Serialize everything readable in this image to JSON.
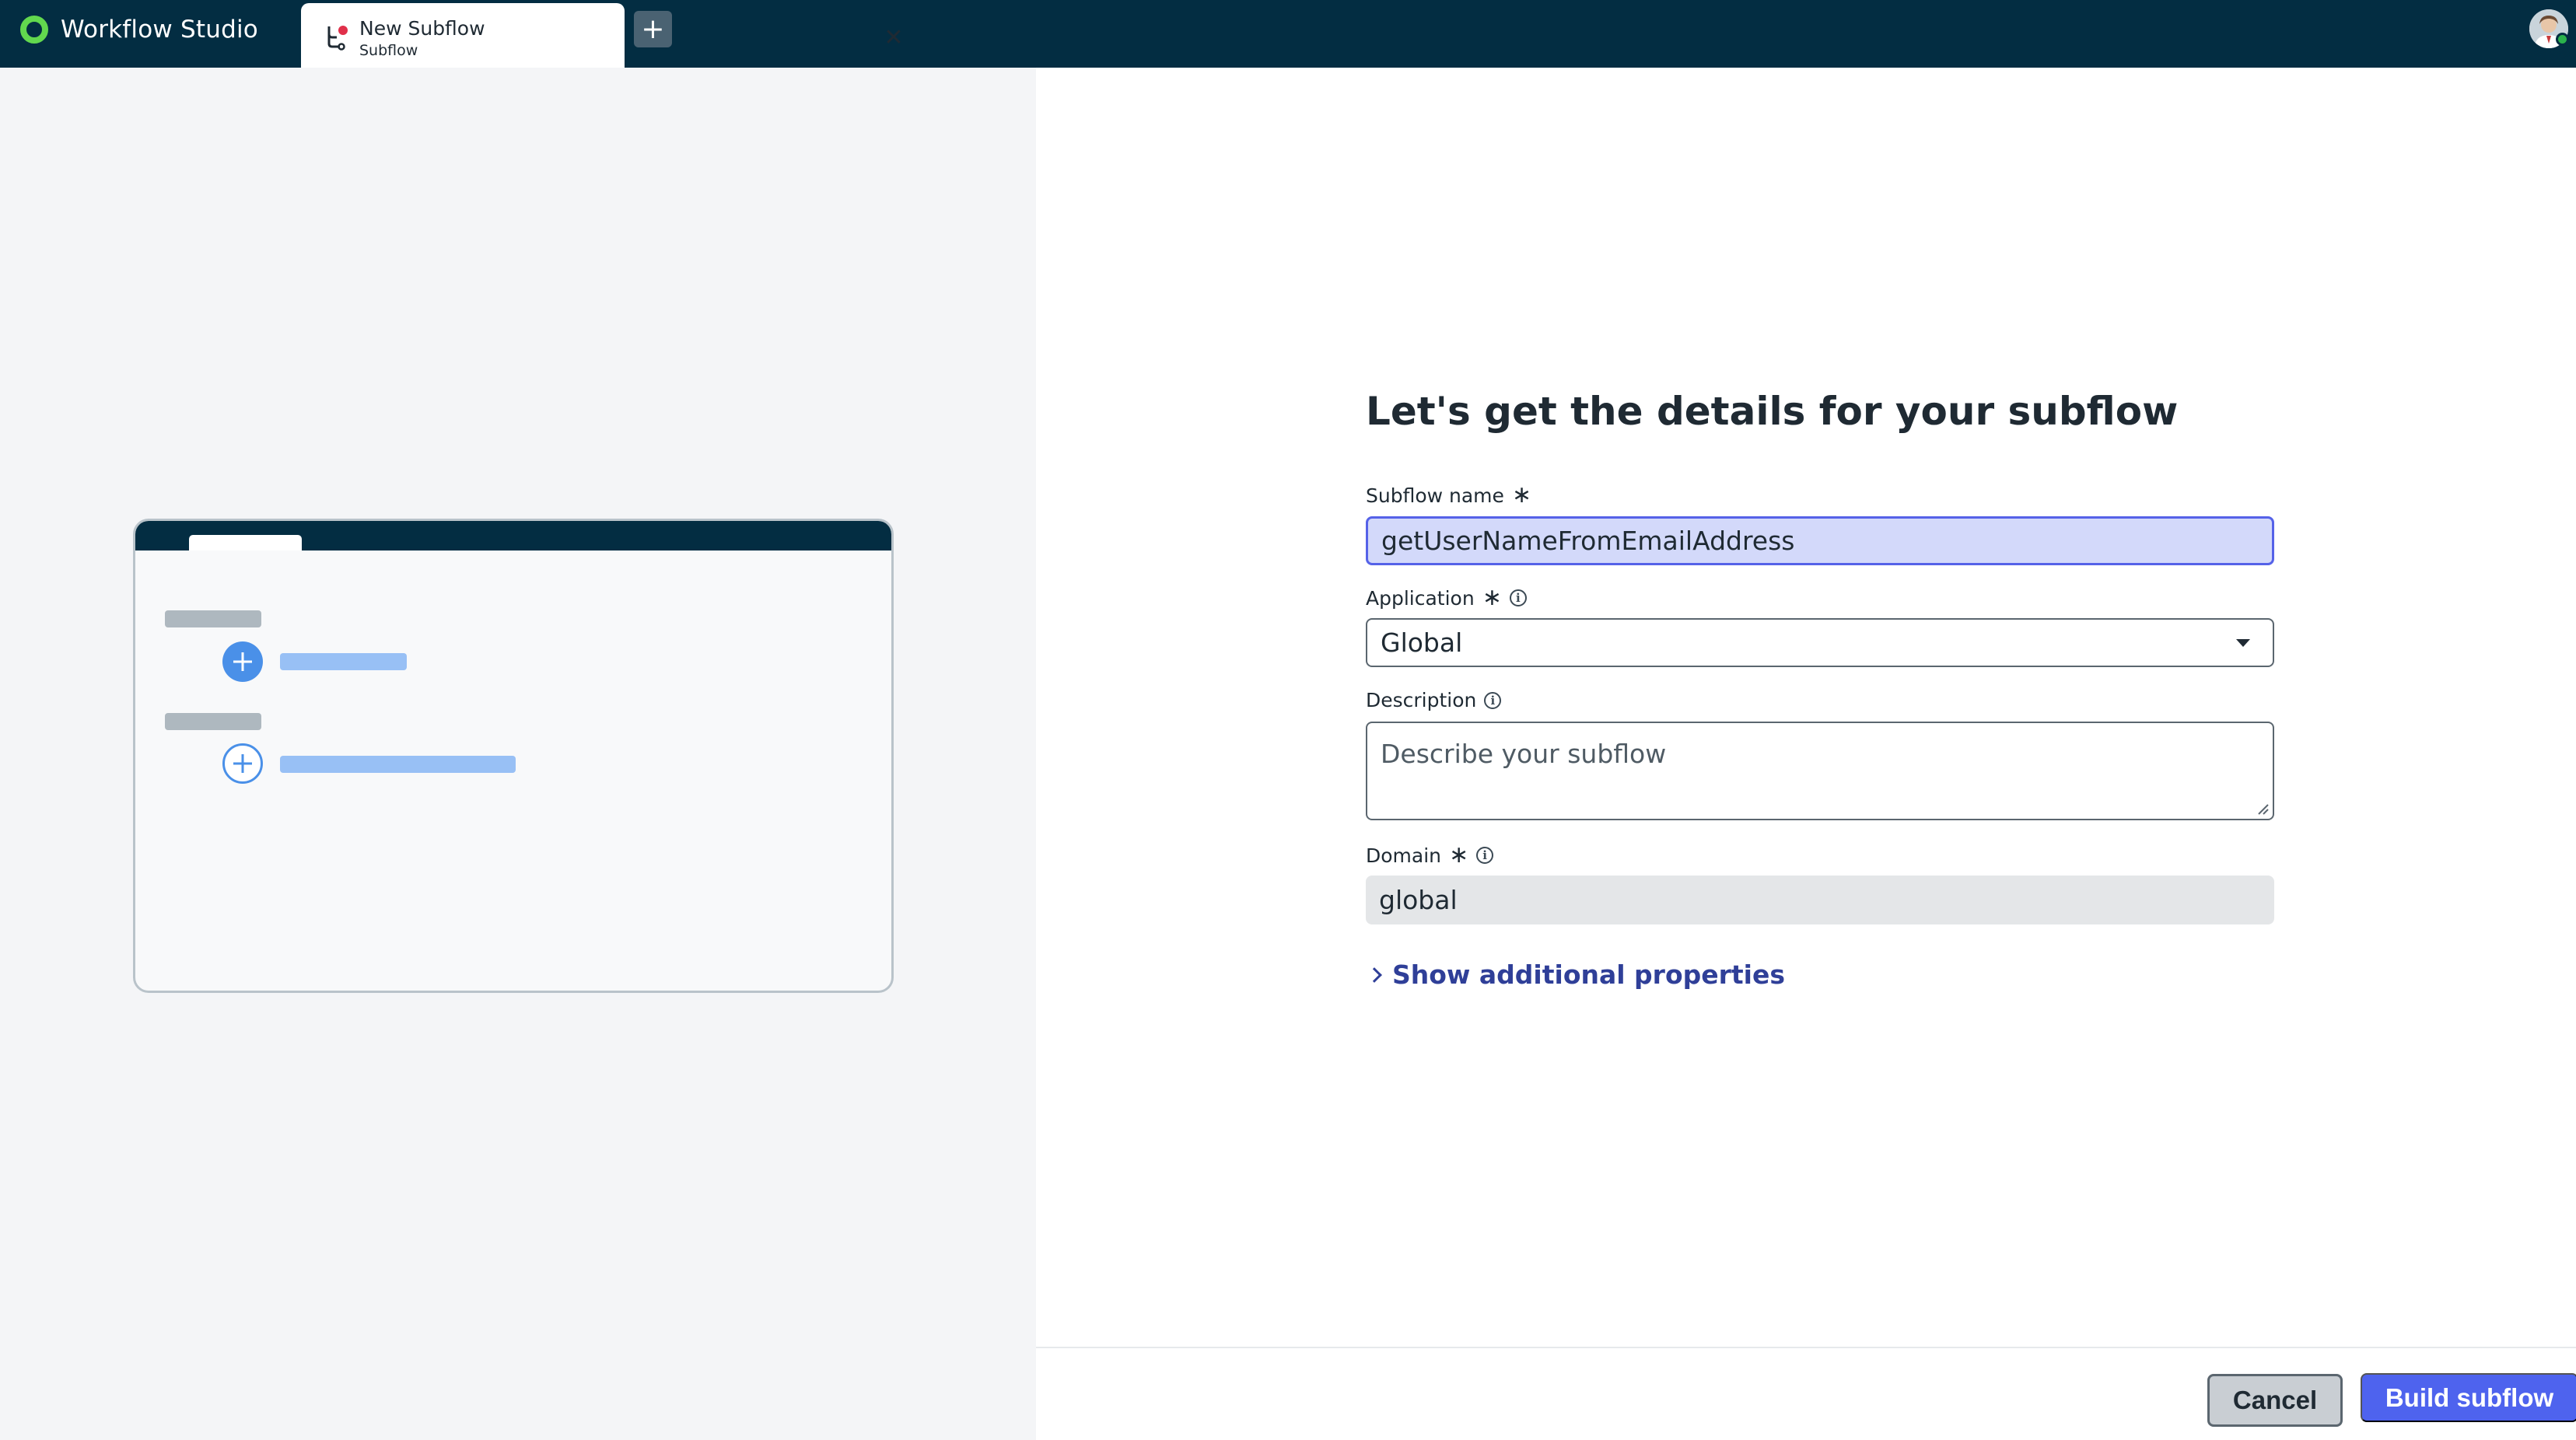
{
  "app": {
    "title": "Workflow Studio",
    "logo_icon": "workflow-studio-logo"
  },
  "tabs": [
    {
      "title": "New Subflow",
      "subtitle": "Subflow",
      "icon": "subflow-icon"
    }
  ],
  "new_tab_label": "+",
  "form": {
    "heading": "Let's get the details for your subflow",
    "subflow_name_label": "Subflow name",
    "subflow_name_value": "getUserNameFromEmailAddress",
    "application_label": "Application",
    "application_value": "Global",
    "description_label": "Description",
    "description_placeholder": "Describe your subflow",
    "domain_label": "Domain",
    "domain_value": "global",
    "additional_link": "Show additional properties",
    "required_marker": "∗"
  },
  "buttons": {
    "cancel": "Cancel",
    "build": "Build subflow"
  },
  "colors": {
    "topbar": "#032d42",
    "accent": "#4e63ee",
    "link": "#2f3f98",
    "logo": "#62d84e",
    "focus_fill": "#d3d9fa",
    "status_online": "#2bb24c"
  }
}
